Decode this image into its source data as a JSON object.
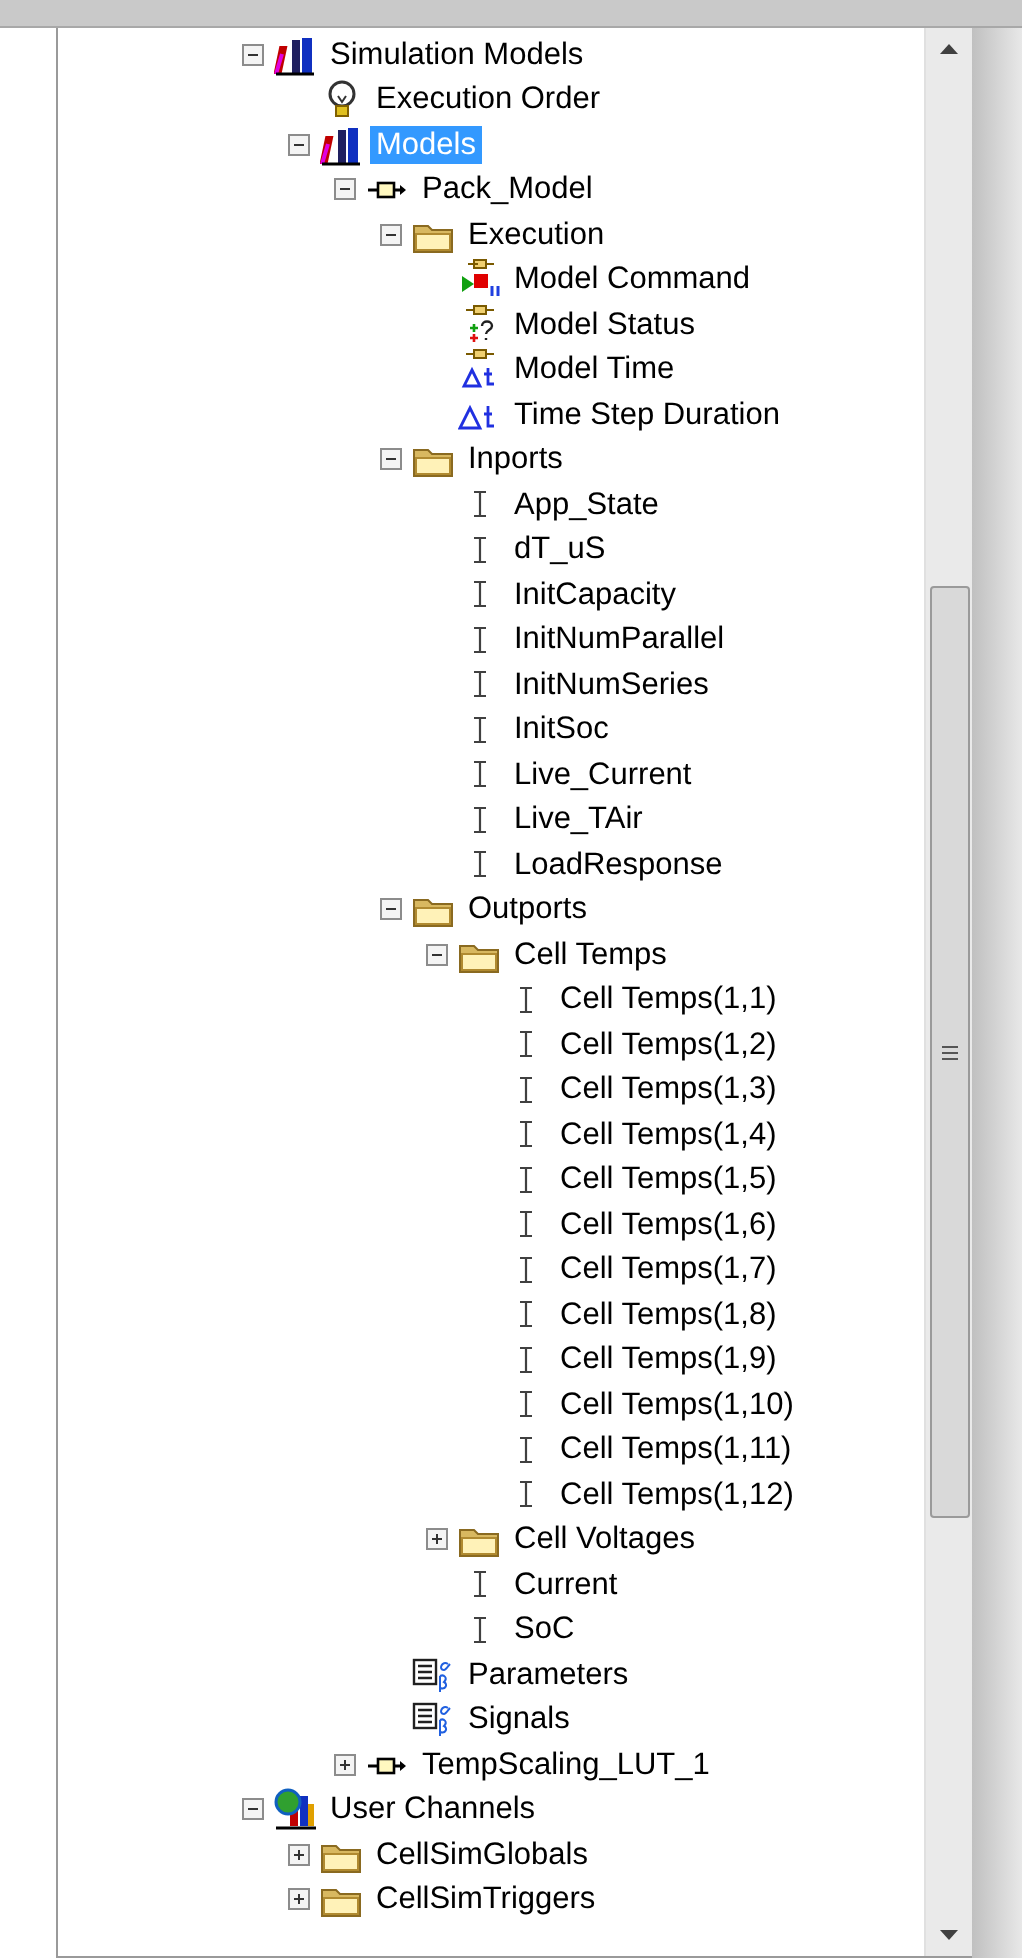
{
  "tree": [
    {
      "label": "Simulation Models",
      "kind": "books",
      "expanded": true,
      "selected": false,
      "children": [
        {
          "label": "Execution Order",
          "kind": "bulb",
          "selected": false
        },
        {
          "label": "Models",
          "kind": "books",
          "expanded": true,
          "selected": true,
          "children": [
            {
              "label": "Pack_Model",
              "kind": "block",
              "expanded": true,
              "selected": false,
              "children": [
                {
                  "label": "Execution",
                  "kind": "folder",
                  "expanded": true,
                  "selected": false,
                  "children": [
                    {
                      "label": "Model Command",
                      "kind": "command",
                      "selected": false
                    },
                    {
                      "label": "Model Status",
                      "kind": "status",
                      "selected": false
                    },
                    {
                      "label": "Model Time",
                      "kind": "time",
                      "selected": false
                    },
                    {
                      "label": "Time Step Duration",
                      "kind": "delta",
                      "selected": false
                    }
                  ]
                },
                {
                  "label": "Inports",
                  "kind": "folder",
                  "expanded": true,
                  "selected": false,
                  "children": [
                    {
                      "label": "App_State",
                      "kind": "port",
                      "selected": false
                    },
                    {
                      "label": "dT_uS",
                      "kind": "port",
                      "selected": false
                    },
                    {
                      "label": "InitCapacity",
                      "kind": "port",
                      "selected": false
                    },
                    {
                      "label": "InitNumParallel",
                      "kind": "port",
                      "selected": false
                    },
                    {
                      "label": "InitNumSeries",
                      "kind": "port",
                      "selected": false
                    },
                    {
                      "label": "InitSoc",
                      "kind": "port",
                      "selected": false
                    },
                    {
                      "label": "Live_Current",
                      "kind": "port",
                      "selected": false
                    },
                    {
                      "label": "Live_TAir",
                      "kind": "port",
                      "selected": false
                    },
                    {
                      "label": "LoadResponse",
                      "kind": "port",
                      "selected": false
                    }
                  ]
                },
                {
                  "label": "Outports",
                  "kind": "folder",
                  "expanded": true,
                  "selected": false,
                  "children": [
                    {
                      "label": "Cell Temps",
                      "kind": "folder",
                      "expanded": true,
                      "selected": false,
                      "children": [
                        {
                          "label": "Cell Temps(1,1)",
                          "kind": "port",
                          "selected": false
                        },
                        {
                          "label": "Cell Temps(1,2)",
                          "kind": "port",
                          "selected": false
                        },
                        {
                          "label": "Cell Temps(1,3)",
                          "kind": "port",
                          "selected": false
                        },
                        {
                          "label": "Cell Temps(1,4)",
                          "kind": "port",
                          "selected": false
                        },
                        {
                          "label": "Cell Temps(1,5)",
                          "kind": "port",
                          "selected": false
                        },
                        {
                          "label": "Cell Temps(1,6)",
                          "kind": "port",
                          "selected": false
                        },
                        {
                          "label": "Cell Temps(1,7)",
                          "kind": "port",
                          "selected": false
                        },
                        {
                          "label": "Cell Temps(1,8)",
                          "kind": "port",
                          "selected": false
                        },
                        {
                          "label": "Cell Temps(1,9)",
                          "kind": "port",
                          "selected": false
                        },
                        {
                          "label": "Cell Temps(1,10)",
                          "kind": "port",
                          "selected": false
                        },
                        {
                          "label": "Cell Temps(1,11)",
                          "kind": "port",
                          "selected": false
                        },
                        {
                          "label": "Cell Temps(1,12)",
                          "kind": "port",
                          "selected": false
                        }
                      ]
                    },
                    {
                      "label": "Cell Voltages",
                      "kind": "folder",
                      "expanded": false,
                      "selected": false
                    },
                    {
                      "label": "Current",
                      "kind": "port",
                      "selected": false
                    },
                    {
                      "label": "SoC",
                      "kind": "port",
                      "selected": false
                    }
                  ]
                },
                {
                  "label": "Parameters",
                  "kind": "table",
                  "selected": false
                },
                {
                  "label": "Signals",
                  "kind": "table",
                  "selected": false
                }
              ]
            },
            {
              "label": "TempScaling_LUT_1",
              "kind": "block",
              "expanded": false,
              "selected": false
            }
          ]
        }
      ]
    },
    {
      "label": "User Channels",
      "kind": "channels",
      "expanded": true,
      "selected": false,
      "children": [
        {
          "label": "CellSimGlobals",
          "kind": "folder",
          "expanded": false,
          "selected": false
        },
        {
          "label": "CellSimTriggers",
          "kind": "folder",
          "expanded": false,
          "selected": false
        }
      ]
    }
  ]
}
